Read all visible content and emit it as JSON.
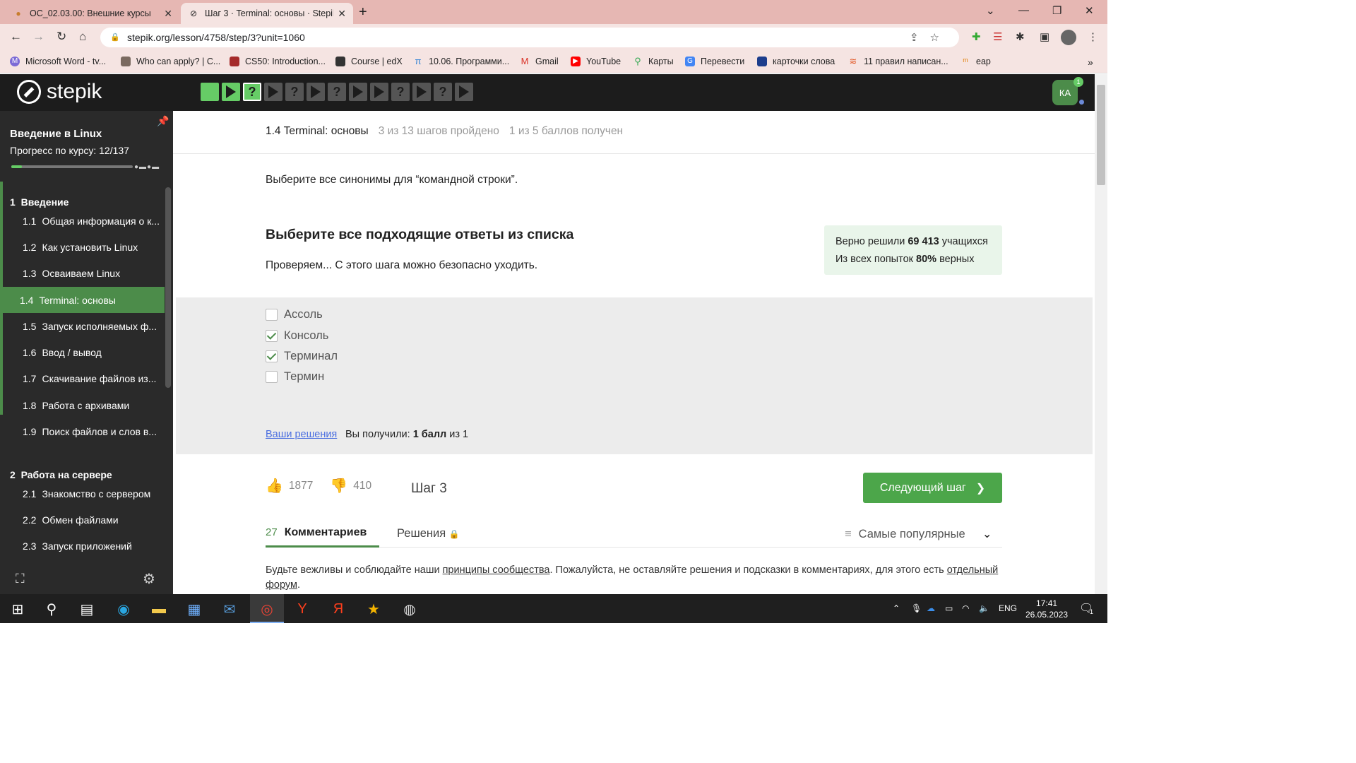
{
  "browser": {
    "tabs": [
      {
        "title": "ОС_02.03.00: Внешние курсы",
        "active": false
      },
      {
        "title": "Шаг 3 · Terminal: основы · Stepik",
        "active": true
      }
    ],
    "url": "stepik.org/lesson/4758/step/3?unit=1060",
    "bookmarks": [
      "Microsoft Word - tv...",
      "Who can apply? | C...",
      "CS50: Introduction...",
      "Course | edX",
      "10.06. Программи...",
      "Gmail",
      "YouTube",
      "Карты",
      "Перевести",
      "карточки слова",
      "11 правил написан...",
      "eap"
    ]
  },
  "header": {
    "logo": "stepik",
    "avatar": "КА",
    "avatar_badge": "1",
    "step_icons": [
      "done",
      "play",
      "question",
      "play",
      "question",
      "play",
      "question",
      "play",
      "play",
      "question",
      "play",
      "question",
      "play"
    ]
  },
  "sidebar": {
    "course_title": "Введение в Linux",
    "progress_label": "Прогресс по курсу:  12/137",
    "progress_fraction": 0.0876,
    "sections": [
      {
        "num": "1",
        "title": "Введение"
      },
      {
        "num": "2",
        "title": "Работа на сервере"
      }
    ],
    "lessons": [
      {
        "num": "1.1",
        "title": "Общая информация о к..."
      },
      {
        "num": "1.2",
        "title": "Как установить Linux"
      },
      {
        "num": "1.3",
        "title": "Осваиваем Linux"
      },
      {
        "num": "1.4",
        "title": "Terminal: основы"
      },
      {
        "num": "1.5",
        "title": "Запуск исполняемых ф..."
      },
      {
        "num": "1.6",
        "title": "Ввод / вывод"
      },
      {
        "num": "1.7",
        "title": "Скачивание файлов из..."
      },
      {
        "num": "1.8",
        "title": "Работа с архивами"
      },
      {
        "num": "1.9",
        "title": "Поиск файлов и слов в..."
      },
      {
        "num": "2.1",
        "title": "Знакомство с сервером"
      },
      {
        "num": "2.2",
        "title": "Обмен файлами"
      },
      {
        "num": "2.3",
        "title": "Запуск приложений"
      }
    ]
  },
  "main": {
    "lesson_title": "1.4 Terminal: основы",
    "steps_passed": "3 из 13 шагов пройдено",
    "points": "1 из 5 баллов  получен",
    "question": "Выберите все синонимы для “командной строки”.",
    "task_title": "Выберите все подходящие ответы из списка",
    "task_status": "Проверяем... С этого шага можно безопасно уходить.",
    "stats_line1_pre": "Верно решили ",
    "stats_line1_num": "69 413",
    "stats_line1_post": " учащихся",
    "stats_line2_pre": "Из всех попыток ",
    "stats_line2_num": "80%",
    "stats_line2_post": " верных",
    "options": [
      {
        "label": "Ассоль",
        "checked": false
      },
      {
        "label": "Консоль",
        "checked": true
      },
      {
        "label": "Терминал",
        "checked": true
      },
      {
        "label": "Термин",
        "checked": false
      }
    ],
    "your_solutions": "Ваши решения",
    "got_pre": "Вы получили: ",
    "got_bold": "1 балл",
    "got_post": " из 1",
    "likes": "1877",
    "dislikes": "410",
    "step_label": "Шаг 3",
    "next_button": "Следующий шаг",
    "comments_count": "27",
    "comments_tab": "Комментариев",
    "solutions_tab": "Решения",
    "sort_label": "Самые популярные",
    "rules_pre": "Будьте вежливы и соблюдайте наши ",
    "rules_link": "принципы сообщества",
    "rules_mid": ". Пожалуйста, не оставляйте решения и подсказки в комментариях, для этого есть ",
    "rules_link2": "отдельный форум",
    "rules_end": "."
  },
  "taskbar": {
    "lang": "ENG",
    "time": "17:41",
    "date": "26.05.2023",
    "notif": "1"
  },
  "colors": {
    "accent_green": "#4c8c4a",
    "header_dark": "#1c1c1c",
    "sidebar_bg": "#2a2a2a",
    "chrome_pink": "#e6b7b3"
  }
}
